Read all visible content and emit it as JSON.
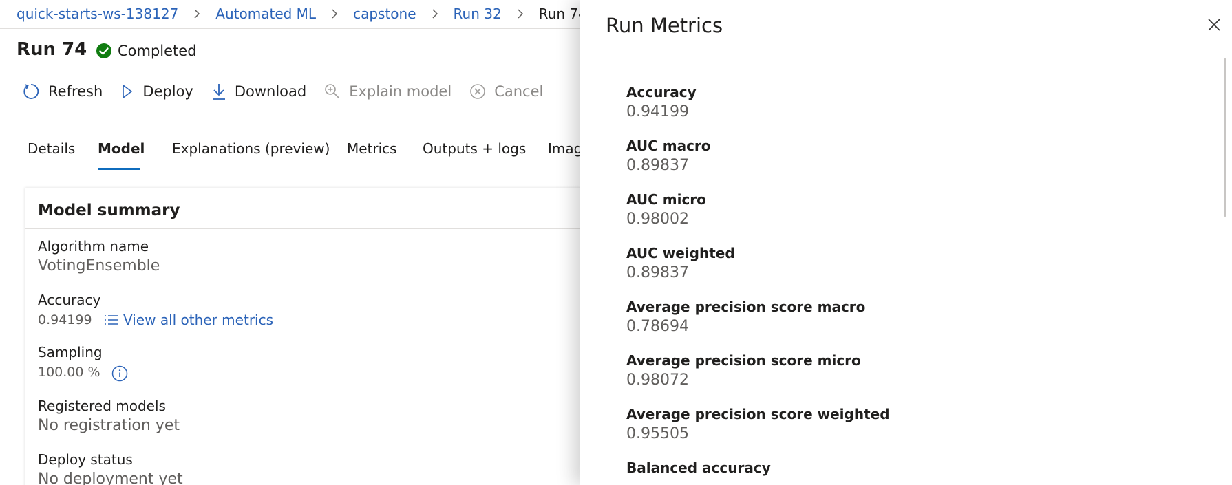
{
  "breadcrumb": {
    "items": [
      {
        "label": "quick-starts-ws-138127"
      },
      {
        "label": "Automated ML"
      },
      {
        "label": "capstone"
      },
      {
        "label": "Run 32"
      },
      {
        "label": "Run 74"
      }
    ]
  },
  "run": {
    "title": "Run 74",
    "status": "Completed"
  },
  "toolbar": {
    "refresh": "Refresh",
    "deploy": "Deploy",
    "download": "Download",
    "explain": "Explain model",
    "cancel": "Cancel"
  },
  "tabs": [
    {
      "label": "Details"
    },
    {
      "label": "Model"
    },
    {
      "label": "Explanations (preview)"
    },
    {
      "label": "Metrics"
    },
    {
      "label": "Outputs + logs"
    },
    {
      "label": "Imag"
    }
  ],
  "model_summary": {
    "title": "Model summary",
    "algorithm_label": "Algorithm name",
    "algorithm_value": "VotingEnsemble",
    "accuracy_label": "Accuracy",
    "accuracy_value": "0.94199",
    "view_metrics": "View all other metrics",
    "sampling_label": "Sampling",
    "sampling_value": "100.00 %",
    "registered_label": "Registered models",
    "registered_value": "No registration yet",
    "deploy_label": "Deploy status",
    "deploy_value": "No deployment yet"
  },
  "panel": {
    "title": "Run Metrics",
    "metrics": [
      {
        "label": "Accuracy",
        "value": "0.94199"
      },
      {
        "label": "AUC macro",
        "value": "0.89837"
      },
      {
        "label": "AUC micro",
        "value": "0.98002"
      },
      {
        "label": "AUC weighted",
        "value": "0.89837"
      },
      {
        "label": "Average precision score macro",
        "value": "0.78694"
      },
      {
        "label": "Average precision score micro",
        "value": "0.98072"
      },
      {
        "label": "Average precision score weighted",
        "value": "0.95505"
      },
      {
        "label": "Balanced accuracy",
        "value": ""
      }
    ]
  },
  "colors": {
    "link": "#2b63b8",
    "accent": "#0f6cbd",
    "success": "#107c10",
    "muted": "#8a8886"
  },
  "icons": {
    "status": "check-circle-icon",
    "refresh": "refresh-icon",
    "deploy": "play-icon",
    "download": "download-icon",
    "explain": "search-plus-icon",
    "cancel": "cancel-circle-icon",
    "view_metrics": "list-icon",
    "sampling_info": "info-icon",
    "close": "close-icon",
    "breadcrumb_separator": "chevron-right-icon"
  }
}
